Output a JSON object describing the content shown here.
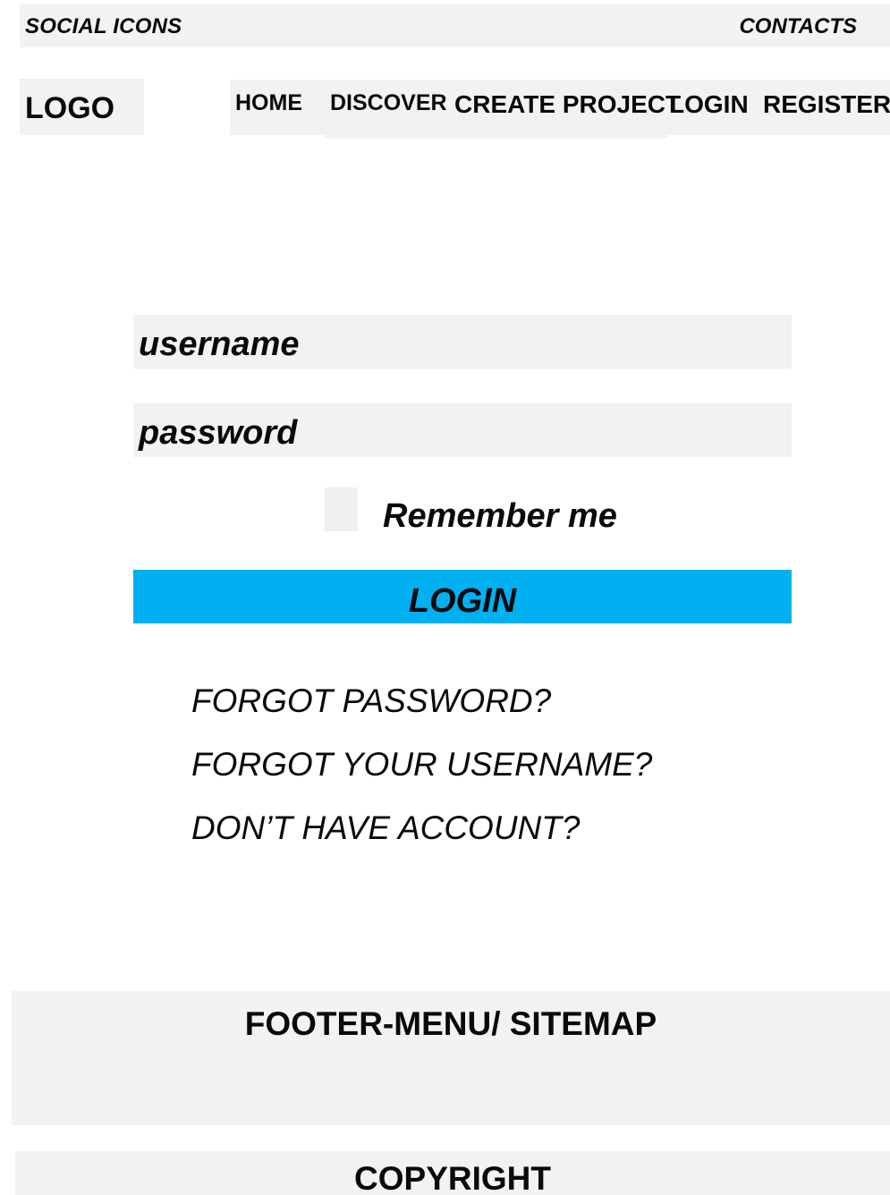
{
  "header": {
    "social_label": "SOCIAL ICONS",
    "contacts_label": "CONTACTS",
    "logo_label": "LOGO"
  },
  "nav": {
    "items": [
      {
        "label": "HOME"
      },
      {
        "label": "DISCOVER"
      },
      {
        "label": "CREATE PROJECT"
      },
      {
        "label": "LOGIN"
      },
      {
        "label": "REGISTER"
      }
    ]
  },
  "form": {
    "username_placeholder": "username",
    "password_placeholder": "password",
    "remember_label": "Remember me",
    "login_button_label": "LOGIN",
    "button_color": "#00b0f0"
  },
  "links": [
    {
      "label": "FORGOT PASSWORD?"
    },
    {
      "label": "FORGOT YOUR USERNAME?"
    },
    {
      "label": "DON’T HAVE ACCOUNT?"
    }
  ],
  "footer": {
    "menu_label": "FOOTER-MENU/ SITEMAP",
    "copyright_label": "COPYRIGHT"
  }
}
